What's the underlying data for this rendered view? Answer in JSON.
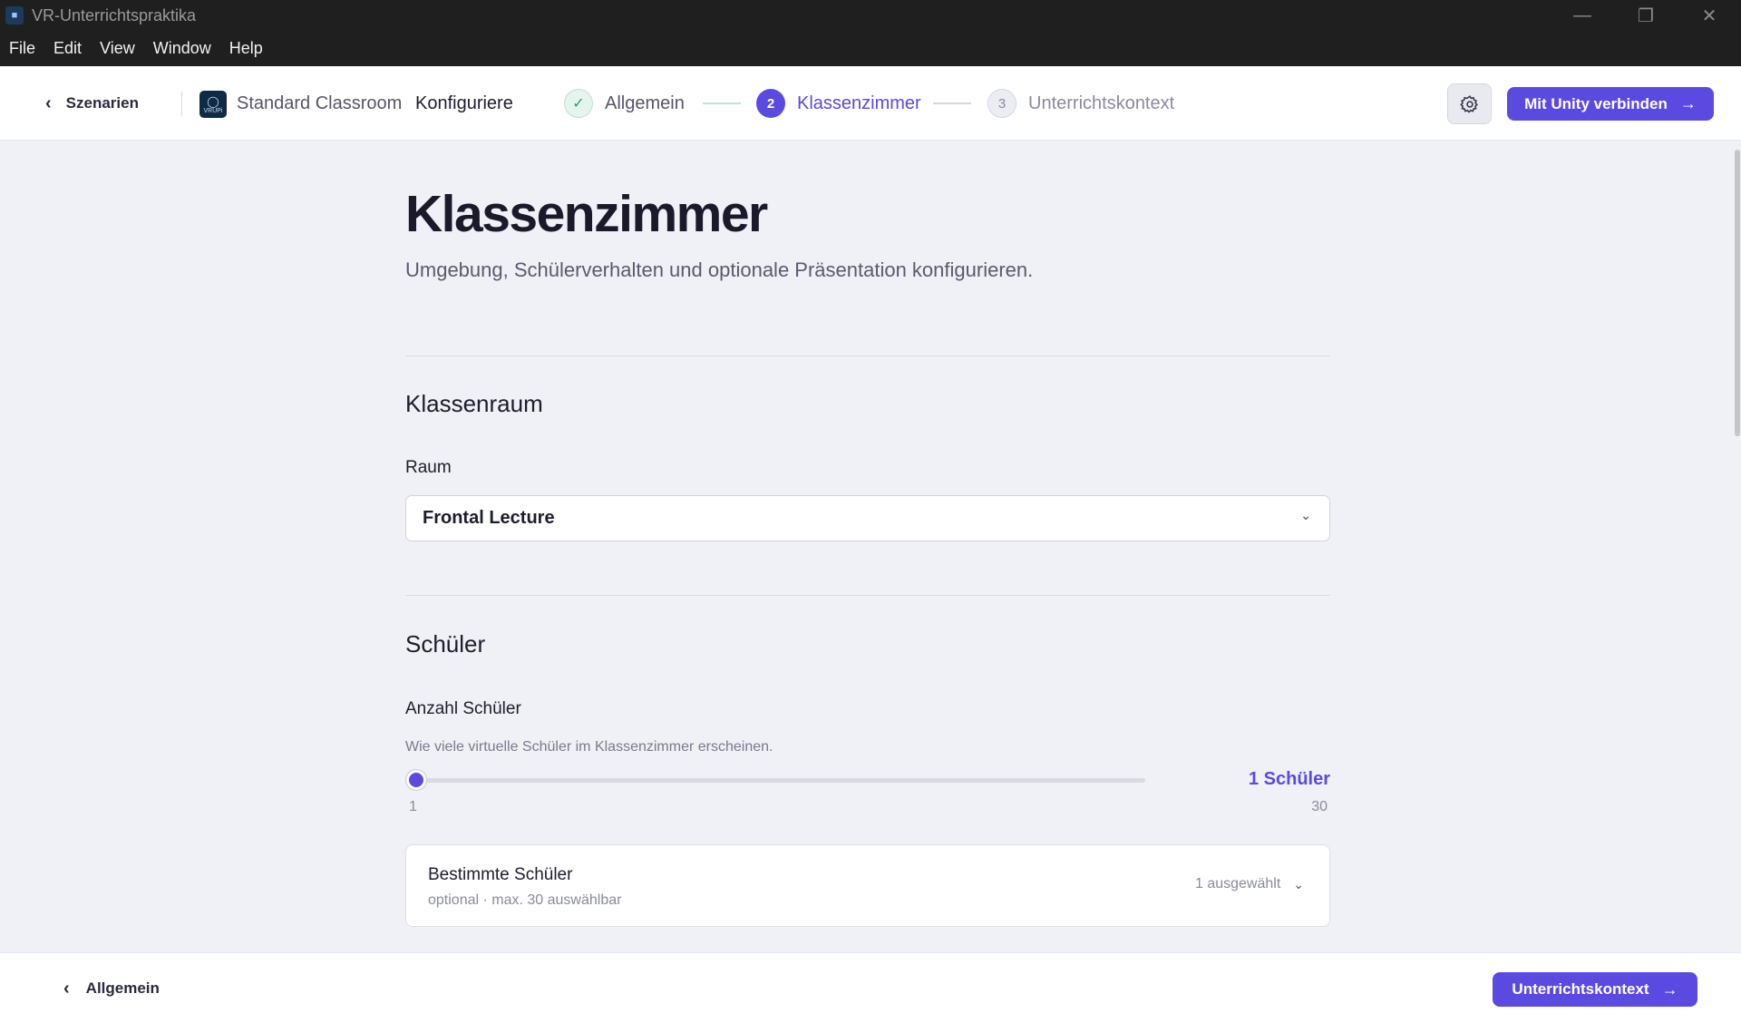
{
  "window": {
    "title": "VR-Unterrichtspraktika",
    "menu": [
      "File",
      "Edit",
      "View",
      "Window",
      "Help"
    ]
  },
  "header": {
    "back_label": "Szenarien",
    "scenario_name": "Standard Classroom",
    "scenario_icon_text": "VRUPi",
    "configure_label": "Konfiguriere",
    "steps": [
      {
        "number": "✓",
        "label": "Allgemein",
        "state": "done"
      },
      {
        "number": "2",
        "label": "Klassenzimmer",
        "state": "active"
      },
      {
        "number": "3",
        "label": "Unterrichtskontext",
        "state": "pending"
      }
    ],
    "connect_button": "Mit Unity verbinden"
  },
  "main": {
    "title": "Klassenzimmer",
    "subtitle": "Umgebung, Schülerverhalten und optionale Präsentation konfigurieren.",
    "classroom_section": {
      "title": "Klassenraum",
      "room_label": "Raum",
      "room_value": "Frontal Lecture"
    },
    "students_section": {
      "title": "Schüler",
      "count_label": "Anzahl Schüler",
      "count_hint": "Wie viele virtuelle Schüler im Klassenzimmer erscheinen.",
      "count_value": 1,
      "count_display": "1 Schüler",
      "min_label": "1",
      "max_label": "30",
      "specific": {
        "title": "Bestimmte Schüler",
        "subtitle": "optional · max. 30 auswählbar",
        "selected": "1 ausgewählt"
      }
    }
  },
  "footer": {
    "back_label": "Allgemein",
    "next_label": "Unterrichtskontext"
  },
  "colors": {
    "accent": "#5b4ae0",
    "success": "#2a9d6a",
    "background": "#f0f0f7"
  }
}
